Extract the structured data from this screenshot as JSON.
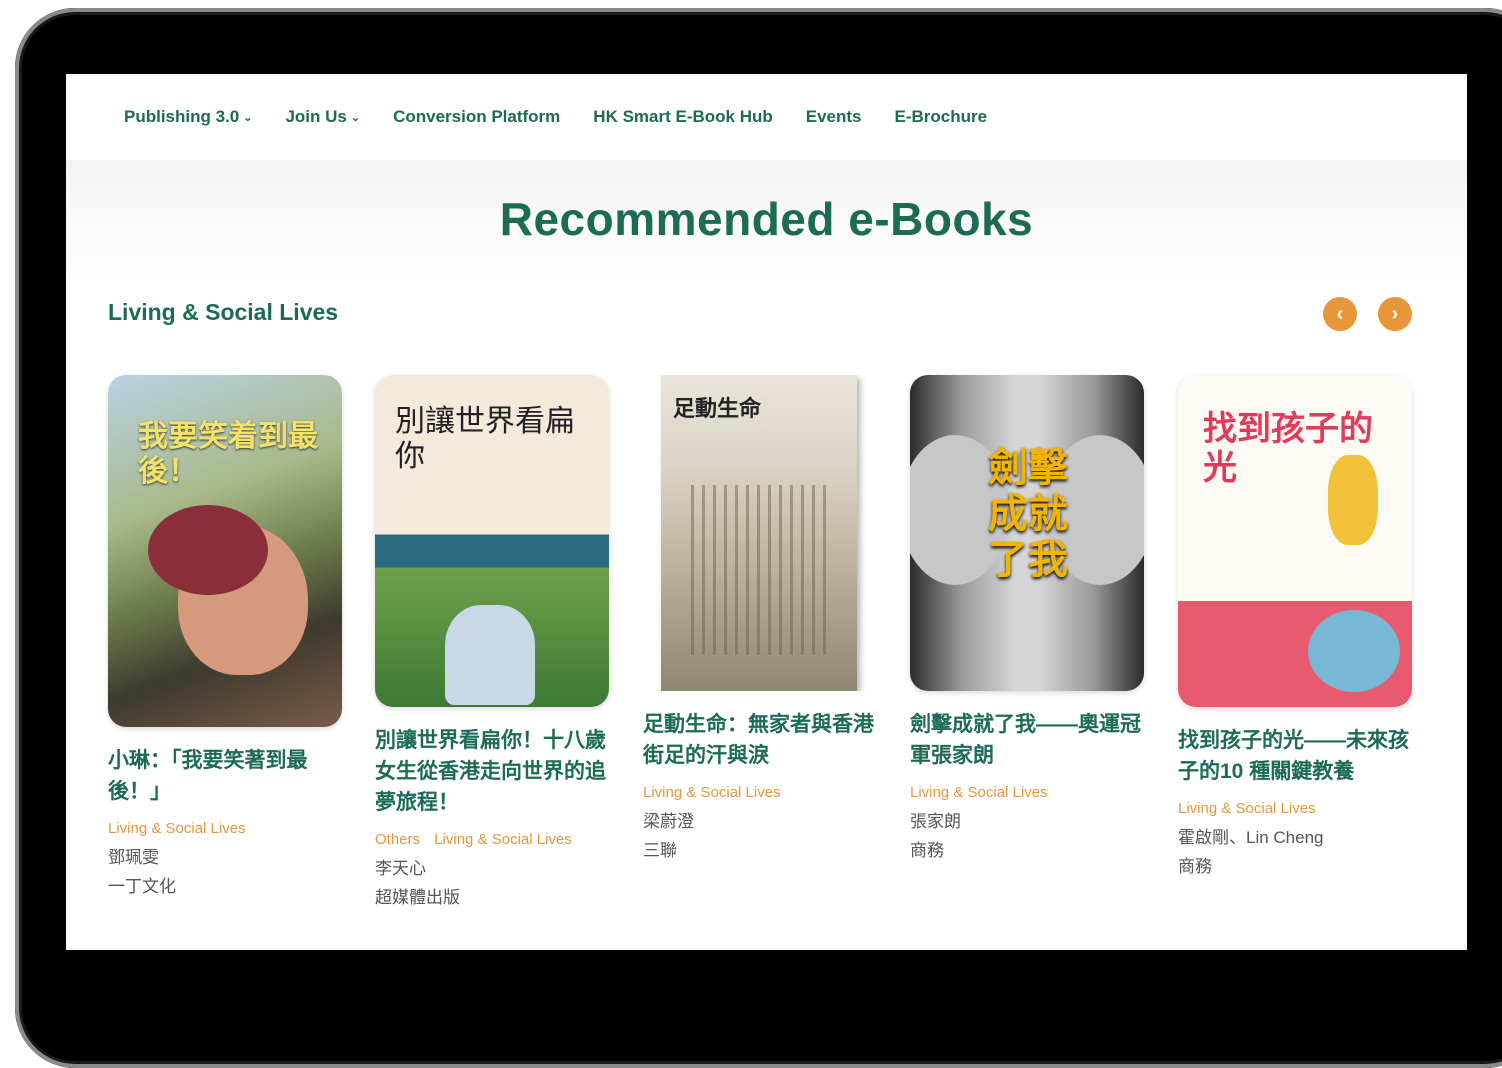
{
  "nav": {
    "items": [
      {
        "label": "Publishing 3.0",
        "dropdown": true
      },
      {
        "label": "Join Us",
        "dropdown": true
      },
      {
        "label": "Conversion Platform",
        "dropdown": false
      },
      {
        "label": "HK Smart E-Book Hub",
        "dropdown": false
      },
      {
        "label": "Events",
        "dropdown": false
      },
      {
        "label": "E-Brochure",
        "dropdown": false
      }
    ],
    "chevron": "⌄"
  },
  "page": {
    "title": "Recommended e-Books"
  },
  "section": {
    "title": "Living & Social Lives",
    "prev_icon": "‹",
    "next_icon": "›"
  },
  "books": [
    {
      "title": "小琳：「我要笑著到最後！」",
      "categories": [
        "Living & Social Lives"
      ],
      "author": "鄧珮雯",
      "publisher": "一丁文化",
      "cover_text": "我要笑着到最後！"
    },
    {
      "title": "別讓世界看扁你！十八歲女生從香港走向世界的追夢旅程！",
      "categories": [
        "Others",
        "Living & Social Lives"
      ],
      "author": "李天心",
      "publisher": "超媒體出版",
      "cover_text": "別讓世界看扁你"
    },
    {
      "title": "足動生命：無家者與香港街足的汗與淚",
      "categories": [
        "Living & Social Lives"
      ],
      "author": "梁蔚澄",
      "publisher": "三聯",
      "cover_text": "足動生命"
    },
    {
      "title": "劍擊成就了我——奧運冠軍張家朗",
      "categories": [
        "Living & Social Lives"
      ],
      "author": "張家朗",
      "publisher": "商務",
      "cover_text": "劍擊成就了我"
    },
    {
      "title": "找到孩子的光——未來孩子的10 種關鍵教養",
      "categories": [
        "Living & Social Lives"
      ],
      "author": "霍啟剛、Lin Cheng",
      "publisher": "商務",
      "cover_text": "找到孩子的光"
    }
  ],
  "colors": {
    "brand_green": "#1c6b54",
    "accent_orange": "#e8963a"
  }
}
